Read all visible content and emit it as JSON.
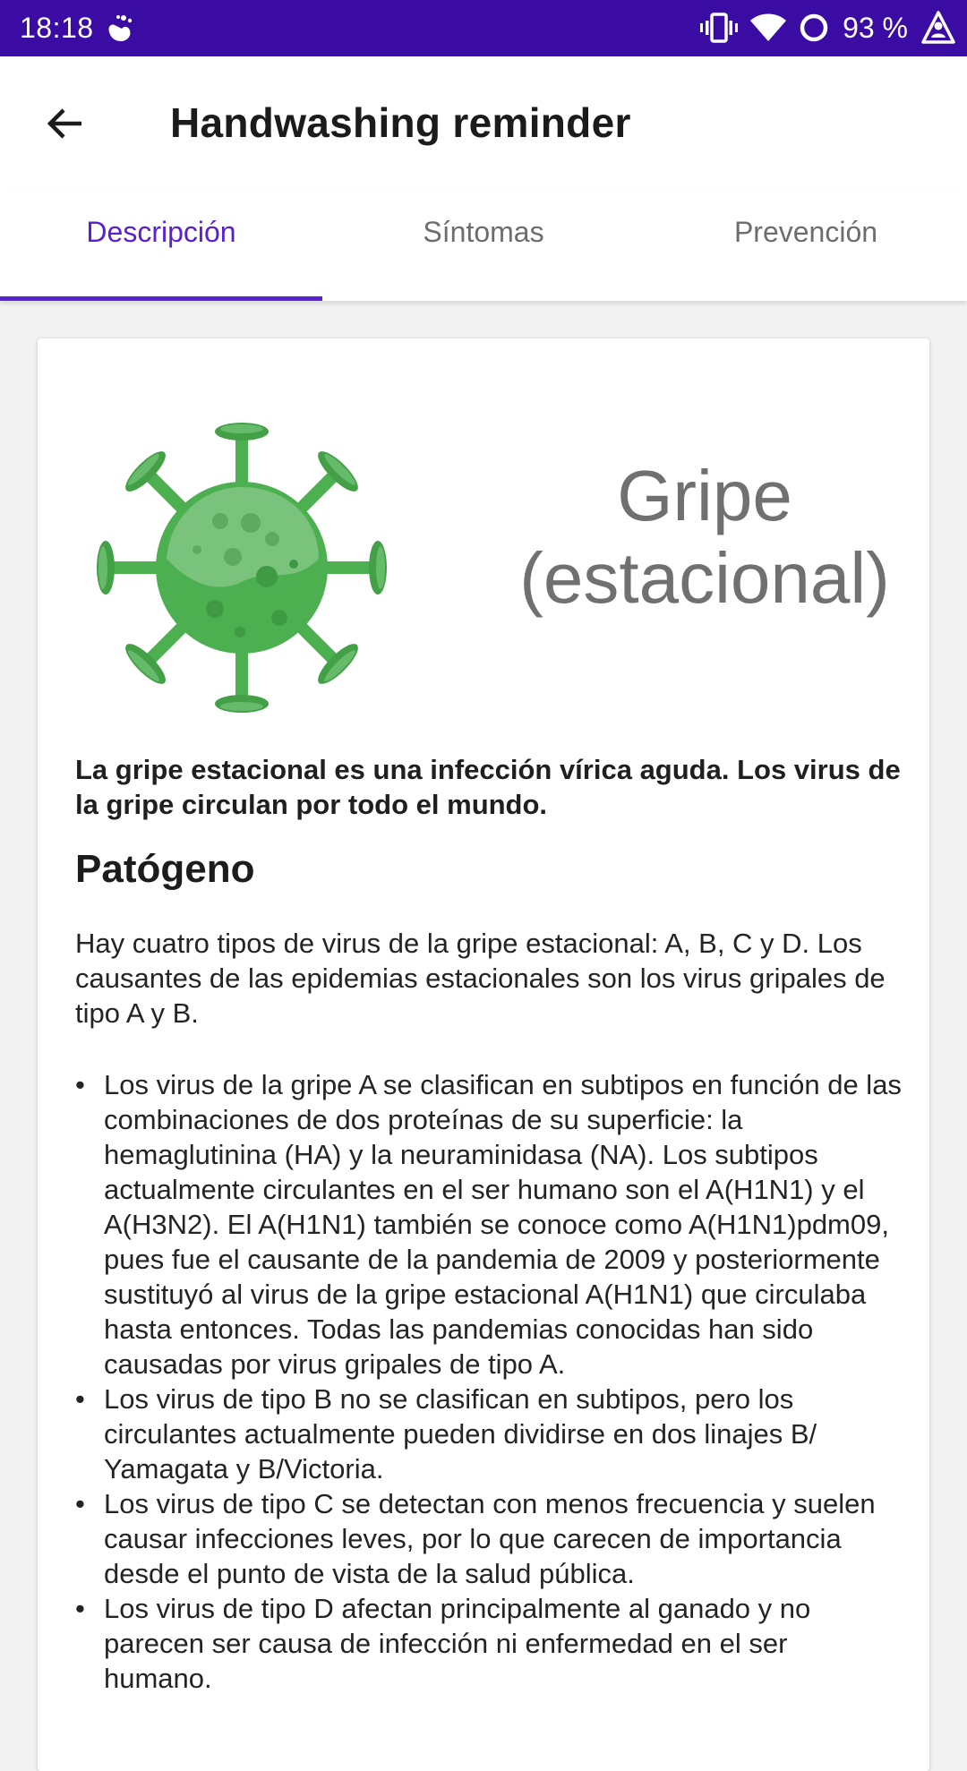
{
  "status_bar": {
    "time": "18:18",
    "battery_percent": "93 %",
    "icons": [
      "handwashing-app-icon",
      "vibrate-icon",
      "wifi-icon",
      "sync-icon",
      "warning-user-icon"
    ]
  },
  "app_bar": {
    "title": "Handwashing reminder",
    "back_icon": "arrow-back-icon"
  },
  "tabs": [
    {
      "label": "Descripción",
      "active": true
    },
    {
      "label": "Síntomas",
      "active": false
    },
    {
      "label": "Prevención",
      "active": false
    }
  ],
  "colors": {
    "status_bar": "#3a0ca3",
    "accent": "#5a20d0",
    "virus_green": "#4caf50"
  },
  "card": {
    "image_icon": "virus-icon",
    "title_line1": "Gripe",
    "title_line2": "(estacional)",
    "intro": "La gripe estacional es una infección vírica aguda. Los virus de la gripe circulan por todo el mundo.",
    "section_heading": "Patógeno",
    "paragraph": "Hay cuatro tipos de virus de la gripe estacional: A, B, C y D. Los causantes de las epidemias estacionales son los virus gripales de tipo A y B.",
    "bullet_symbol": "•",
    "bullets": [
      "Los virus de la gripe A se clasifican en subtipos en función de las combinaciones de dos proteínas de su superficie: la hemaglutinina (HA) y la neuraminidasa (NA). Los subtipos actualmente circulantes en el ser humano son el A(H1N1) y el A(H3N2). El A(H1N1) también se conoce como A(H1N1)pdm09, pues fue el causante de la pandemia de 2009 y posteriormente sustituyó al virus de la gripe estacional A(H1N1) que circulaba hasta entonces. Todas las pandemias conocidas han sido causadas por virus gripales de tipo A.",
      "Los virus de tipo B no se clasifican en subtipos, pero los circulantes actualmente pueden dividirse en dos linajes B/ Yamagata y B/Victoria.",
      "Los virus de tipo C se detectan con menos frecuencia y suelen causar infecciones leves, por lo que carecen de importancia desde el punto de vista de la salud pública.",
      "Los virus de tipo D afectan principalmente al ganado y no parecen ser causa de infección ni enfermedad en el ser humano."
    ]
  }
}
